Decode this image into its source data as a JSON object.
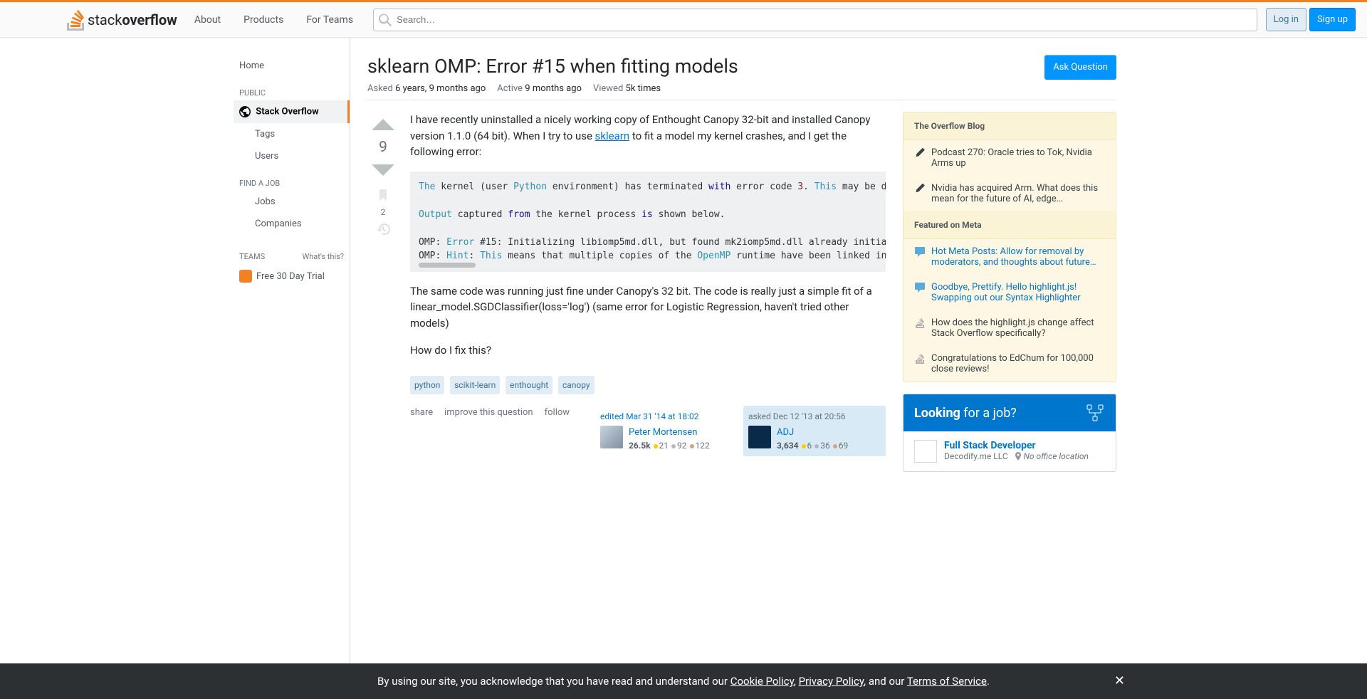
{
  "header": {
    "logo_light": "stack",
    "logo_bold": "overflow",
    "nav": {
      "about": "About",
      "products": "Products",
      "teams": "For Teams"
    },
    "search_placeholder": "Search…",
    "login": "Log in",
    "signup": "Sign up"
  },
  "sidebar": {
    "home": "Home",
    "public_label": "PUBLIC",
    "stack_overflow": "Stack Overflow",
    "tags": "Tags",
    "users": "Users",
    "find_job_label": "FIND A JOB",
    "jobs": "Jobs",
    "companies": "Companies",
    "teams_label": "TEAMS",
    "whats_this": "What's this?",
    "trial": "Free 30 Day Trial"
  },
  "question": {
    "title": "sklearn OMP: Error #15 when fitting models",
    "ask_button": "Ask Question",
    "asked_label": "Asked",
    "asked_value": "6 years, 9 months ago",
    "active_label": "Active",
    "active_value": "9 months ago",
    "viewed_label": "Viewed",
    "viewed_value": "5k times",
    "vote_count": "9",
    "bookmark_count": "2",
    "body_p1_a": "I have recently uninstalled a nicely working copy of Enthought Canopy 32-bit and installed Canopy version 1.1.0 (64 bit). When I try to use ",
    "body_p1_link": "sklearn",
    "body_p1_b": " to fit a model my kernel crashes, and I get the following error:",
    "code_block": "The kernel (user Python environment) has terminated with error code 3. This may be due to a\n\nOutput captured from the kernel process is shown below.\n\nOMP: Error #15: Initializing libiomp5md.dll, but found mk2iomp5md.dll already initialized.\nOMP: Hint: This means that multiple copies of the OpenMP runtime have been linked into the",
    "body_p2": "The same code was running just fine under Canopy's 32 bit. The code is really just a simple fit of a linear_model.SGDClassifier(loss='log') (same error for Logistic Regression, haven't tried other models)",
    "body_p3": "How do I fix this?",
    "tags": [
      "python",
      "scikit-learn",
      "enthought",
      "canopy"
    ],
    "actions": {
      "share": "share",
      "improve": "improve this question",
      "follow": "follow"
    },
    "editor": {
      "time": "edited Mar 31 '14 at 18:02",
      "name": "Peter Mortensen",
      "rep": "26.5k",
      "gold": "21",
      "silver": "92",
      "bronze": "122"
    },
    "owner": {
      "time": "asked Dec 12 '13 at 20:56",
      "name": "ADJ",
      "rep": "3,634",
      "gold": "6",
      "silver": "36",
      "bronze": "69"
    }
  },
  "bulletin": {
    "blog_header": "The Overflow Blog",
    "blog_items": [
      "Podcast 270: Oracle tries to Tok, Nvidia Arms up",
      "Nvidia has acquired Arm. What does this mean for the future of AI, edge…"
    ],
    "meta_header": "Featured on Meta",
    "meta_items": [
      "Hot Meta Posts: Allow for removal by moderators, and thoughts about future…",
      "Goodbye, Prettify. Hello highlight.js! Swapping out our Syntax Highlighter",
      "How does the highlight.js change affect Stack Overflow specifically?",
      "Congratulations to EdChum for 100,000 close reviews!"
    ]
  },
  "jobs": {
    "header_a": "Looking",
    "header_b": " for a job?",
    "item": {
      "title": "Full Stack Developer",
      "company": "Decodify.me LLC",
      "location": "No office location"
    }
  },
  "cookie": {
    "text_a": "By using our site, you acknowledge that you have read and understand our ",
    "cookie_policy": "Cookie Policy",
    "sep1": ", ",
    "privacy_policy": "Privacy Policy",
    "sep2": ", and our ",
    "tos": "Terms of Service",
    "dot": "."
  }
}
